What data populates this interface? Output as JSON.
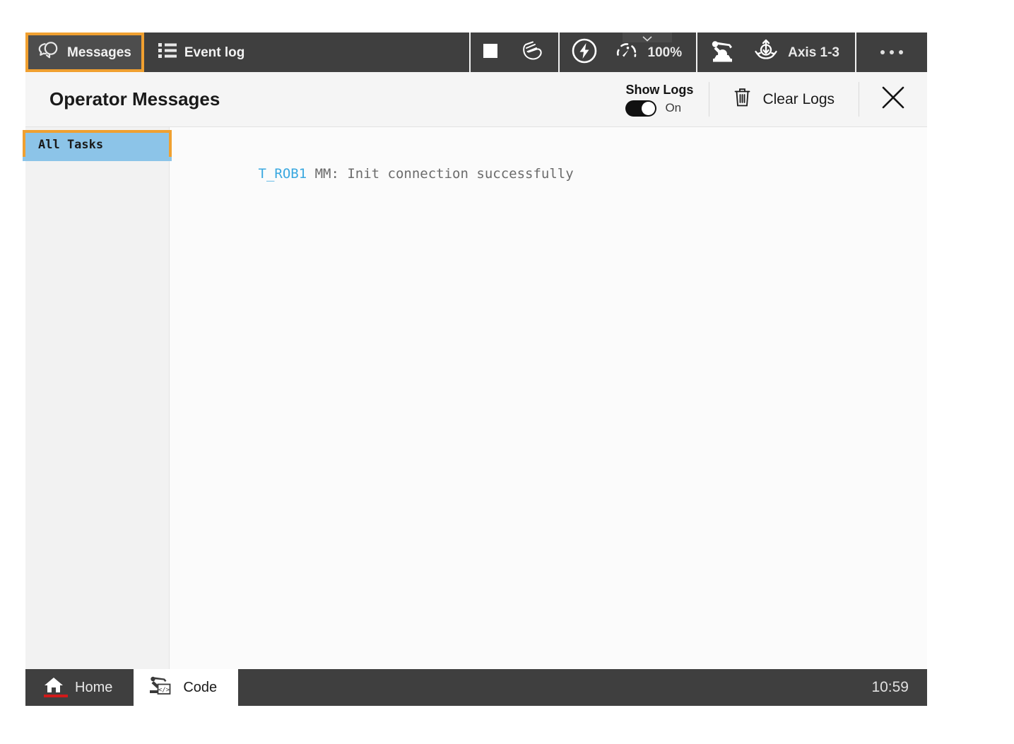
{
  "toolbar": {
    "tabs": [
      {
        "label": "Messages",
        "icon": "messages-icon",
        "selected": true
      },
      {
        "label": "Event log",
        "icon": "list-icon",
        "selected": false
      }
    ],
    "stop_button": {
      "icon": "stop-square-icon"
    },
    "jog_button": {
      "icon": "hand-icon"
    },
    "motors_button": {
      "icon": "lightning-bolt-icon"
    },
    "speed": {
      "icon": "speed-gauge-icon",
      "value": "100%"
    },
    "robot_button": {
      "icon": "robot-arm-icon"
    },
    "axis_button": {
      "icon": "axis-rotation-icon",
      "label": "Axis 1-3"
    },
    "overflow_button": {
      "icon": "ellipsis-icon",
      "label": "..."
    }
  },
  "panel": {
    "title": "Operator Messages",
    "show_logs": {
      "label": "Show Logs",
      "state": "On",
      "enabled": true
    },
    "clear_logs": {
      "label": "Clear Logs",
      "icon": "trash-icon"
    },
    "close": {
      "icon": "close-icon"
    }
  },
  "sidebar": {
    "items": [
      {
        "label": "All Tasks",
        "selected": true,
        "focused": true
      }
    ]
  },
  "messages": [
    {
      "task": "T_ROB1",
      "text": " MM: Init connection successfully"
    }
  ],
  "taskbar": {
    "home": {
      "label": "Home",
      "icon": "home-icon",
      "active": true
    },
    "code": {
      "label": "Code",
      "icon": "robot-code-icon",
      "active": true
    },
    "clock": "10:59"
  },
  "colors": {
    "toolbar_bg": "#3f3f3f",
    "focus_orange": "#f0a030",
    "selection_blue": "#8cc4e8",
    "task_link_blue": "#3aa8e0",
    "home_underline_red": "#d11a1a"
  }
}
